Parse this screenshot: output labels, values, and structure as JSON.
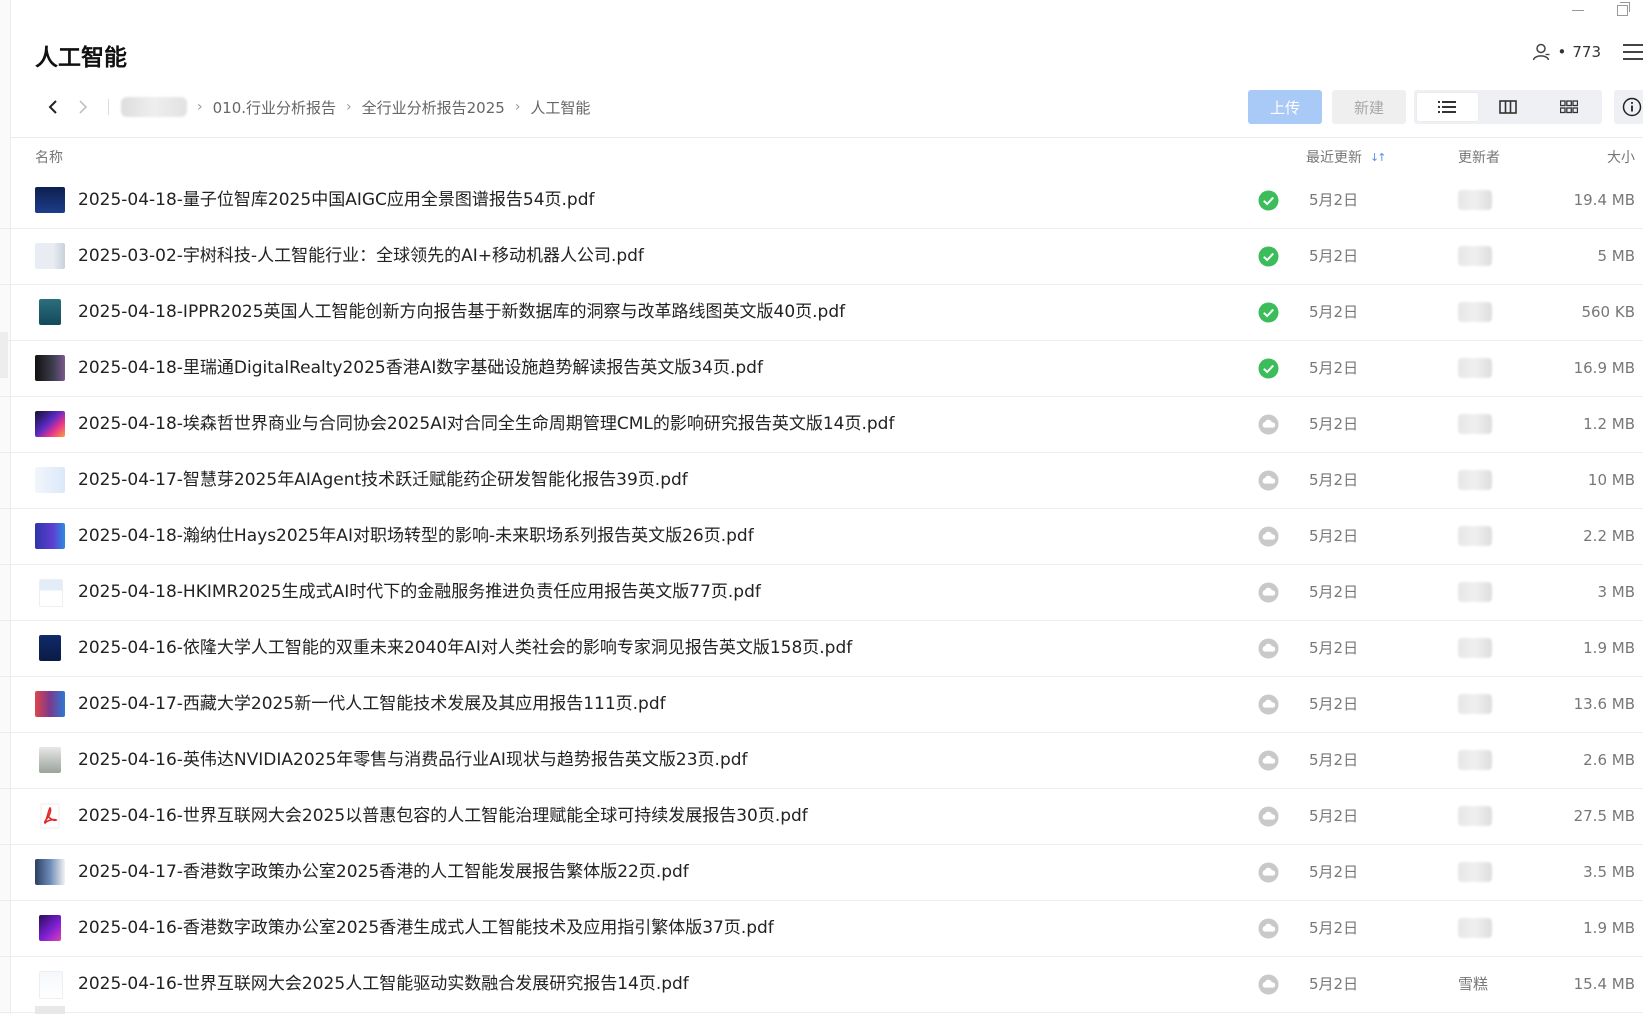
{
  "title": "人工智能",
  "members": {
    "count": "773",
    "dot": "•"
  },
  "breadcrumb": {
    "items": [
      "010.行业分析报告",
      "全行业分析报告2025",
      "人工智能"
    ]
  },
  "toolbar": {
    "upload_label": "上传",
    "new_label": "新建"
  },
  "columns": {
    "name": "名称",
    "updated": "最近更新",
    "updater": "更新者",
    "size": "大小"
  },
  "colors": {
    "accent": "#5a8fe8",
    "synced_green": "#3cbc5a",
    "pending_gray": "#c9c9c9",
    "upload_btn": "#a9c9f6"
  },
  "files": [
    {
      "name": "2025-04-18-量子位智库2025中国AIGC应用全景图谱报告54页.pdf",
      "status": "synced",
      "date": "5月2日",
      "updater": "",
      "size": "19.4 MB",
      "thumb": "dark-blue-cover"
    },
    {
      "name": "2025-03-02-宇树科技-人工智能行业：全球领先的AI+移动机器人公司.pdf",
      "status": "synced",
      "date": "5月2日",
      "updater": "",
      "size": "5 MB",
      "thumb": "light-robot-cover"
    },
    {
      "name": "2025-04-18-IPPR2025英国人工智能创新方向报告基于新数据库的洞察与改革路线图英文版40页.pdf",
      "status": "synced",
      "date": "5月2日",
      "updater": "",
      "size": "560 KB",
      "thumb": "teal-portrait-cover"
    },
    {
      "name": "2025-04-18-里瑞通DigitalRealty2025香港AI数字基础设施趋势解读报告英文版34页.pdf",
      "status": "synced",
      "date": "5月2日",
      "updater": "",
      "size": "16.9 MB",
      "thumb": "dark-photo-cover"
    },
    {
      "name": "2025-04-18-埃森哲世界商业与合同协会2025AI对合同全生命周期管理CML的影响研究报告英文版14页.pdf",
      "status": "pending",
      "date": "5月2日",
      "updater": "",
      "size": "1.2 MB",
      "thumb": "colorful-wave-cover"
    },
    {
      "name": "2025-04-17-智慧芽2025年AIAgent技术跃迁赋能药企研发智能化报告39页.pdf",
      "status": "pending",
      "date": "5月2日",
      "updater": "",
      "size": "10 MB",
      "thumb": "light-blue-cover"
    },
    {
      "name": "2025-04-18-瀚纳仕Hays2025年AI对职场转型的影响-未来职场系列报告英文版26页.pdf",
      "status": "pending",
      "date": "5月2日",
      "updater": "",
      "size": "2.2 MB",
      "thumb": "purple-blue-cover"
    },
    {
      "name": "2025-04-18-HKIMR2025生成式AI时代下的金融服务推进负责任应用报告英文版77页.pdf",
      "status": "pending",
      "date": "5月2日",
      "updater": "",
      "size": "3 MB",
      "thumb": "white-doc-cover"
    },
    {
      "name": "2025-04-16-依隆大学人工智能的双重未来2040年AI对人类社会的影响专家洞见报告英文版158页.pdf",
      "status": "pending",
      "date": "5月2日",
      "updater": "",
      "size": "1.9 MB",
      "thumb": "navy-portrait-cover"
    },
    {
      "name": "2025-04-17-西藏大学2025新一代人工智能技术发展及其应用报告111页.pdf",
      "status": "pending",
      "date": "5月2日",
      "updater": "",
      "size": "13.6 MB",
      "thumb": "red-blue-gradient-cover"
    },
    {
      "name": "2025-04-16-英伟达NVIDIA2025年零售与消费品行业AI现状与趋势报告英文版23页.pdf",
      "status": "pending",
      "date": "5月2日",
      "updater": "",
      "size": "2.6 MB",
      "thumb": "store-photo-cover"
    },
    {
      "name": "2025-04-16-世界互联网大会2025以普惠包容的人工智能治理赋能全球可持续发展报告30页.pdf",
      "status": "pending",
      "date": "5月2日",
      "updater": "",
      "size": "27.5 MB",
      "thumb": "pdf-icon"
    },
    {
      "name": "2025-04-17-香港数字政策办公室2025香港的人工智能发展报告繁体版22页.pdf",
      "status": "pending",
      "date": "5月2日",
      "updater": "",
      "size": "3.5 MB",
      "thumb": "mixed-graphic-cover"
    },
    {
      "name": "2025-04-16-香港数字政策办公室2025香港生成式人工智能技术及应用指引繁体版37页.pdf",
      "status": "pending",
      "date": "5月2日",
      "updater": "",
      "size": "1.9 MB",
      "thumb": "purple-gradient-cover"
    },
    {
      "name": "2025-04-16-世界互联网大会2025人工智能驱动实数融合发展研究报告14页.pdf",
      "status": "pending",
      "date": "5月2日",
      "updater": "雪糕",
      "size": "15.4 MB",
      "thumb": "light-doc-cover"
    }
  ]
}
